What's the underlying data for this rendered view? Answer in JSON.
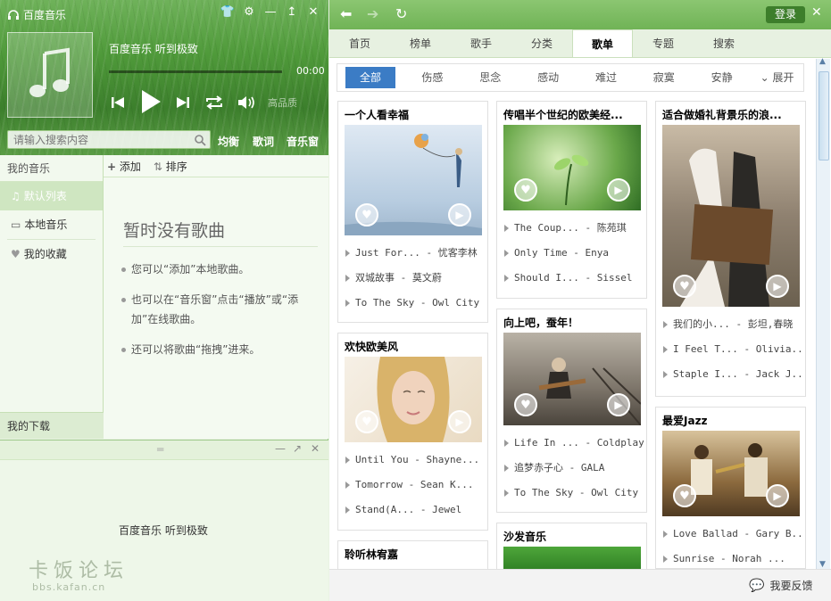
{
  "app": {
    "name": "百度音乐"
  },
  "player": {
    "song_title": "百度音乐 听到极致",
    "time": "00:00",
    "quality": "高品质",
    "progress": 0,
    "links": [
      "均衡",
      "歌词",
      "音乐窗"
    ]
  },
  "search": {
    "placeholder": "请输入搜索内容"
  },
  "sidebar": {
    "header": "我的音乐",
    "items": [
      {
        "label": "默认列表",
        "icon": "note-icon"
      },
      {
        "label": "本地音乐",
        "icon": "monitor-icon"
      },
      {
        "label": "我的收藏",
        "icon": "heart-icon"
      }
    ],
    "footer": "我的下载"
  },
  "list": {
    "add_label": "添加",
    "sort_label": "排序",
    "empty_title": "暂时没有歌曲",
    "tips": [
      "您可以“添加”本地歌曲。",
      "也可以在“音乐窗”点击“播放”或“添加”在线歌曲。",
      "还可以将歌曲“拖拽”进来。"
    ]
  },
  "mini": {
    "text": "百度音乐 听到极致"
  },
  "watermark": {
    "line1": "卡饭论坛",
    "line2": "bbs.kafan.cn"
  },
  "topbar": {
    "login": "登录"
  },
  "tabs": [
    "首页",
    "榜单",
    "歌手",
    "分类",
    "歌单",
    "专题",
    "搜索"
  ],
  "active_tab": "歌单",
  "categories": [
    "全部",
    "伤感",
    "思念",
    "感动",
    "难过",
    "寂寞",
    "安静"
  ],
  "expand_label": "展开",
  "cards": [
    {
      "title": "一个人看幸福",
      "tracks": [
        "Just For... - 忧客李林",
        "双城故事 - 莫文蔚",
        "To The Sky - Owl City"
      ]
    },
    {
      "title": "传唱半个世纪的欧美经...",
      "tracks": [
        "The Coup... - 陈苑琪",
        "Only Time - Enya",
        "Should I... - Sissel"
      ]
    },
    {
      "title": "适合做婚礼背景乐的浪...",
      "tracks": [
        "我们的小... - 彭坦,春晓",
        "I Feel T... - Olivia...",
        "Staple I... - Jack J..."
      ]
    },
    {
      "title": "欢快欧美风",
      "tracks": [
        "Until You - Shayne...",
        "Tomorrow - Sean K...",
        "Stand(A... - Jewel"
      ]
    },
    {
      "title": "向上吧，蚕年！",
      "tracks": [
        "Life In ... - Coldplay",
        "追梦赤子心 - GALA",
        "To The Sky - Owl City"
      ]
    },
    {
      "title": "最爱Jazz",
      "tracks": [
        "Love Ballad - Gary B...",
        "Sunrise - Norah ..."
      ]
    },
    {
      "title": "聆听林宥嘉",
      "tracks": []
    },
    {
      "title": "沙发音乐",
      "tracks": []
    }
  ],
  "feedback": "我要反馈"
}
